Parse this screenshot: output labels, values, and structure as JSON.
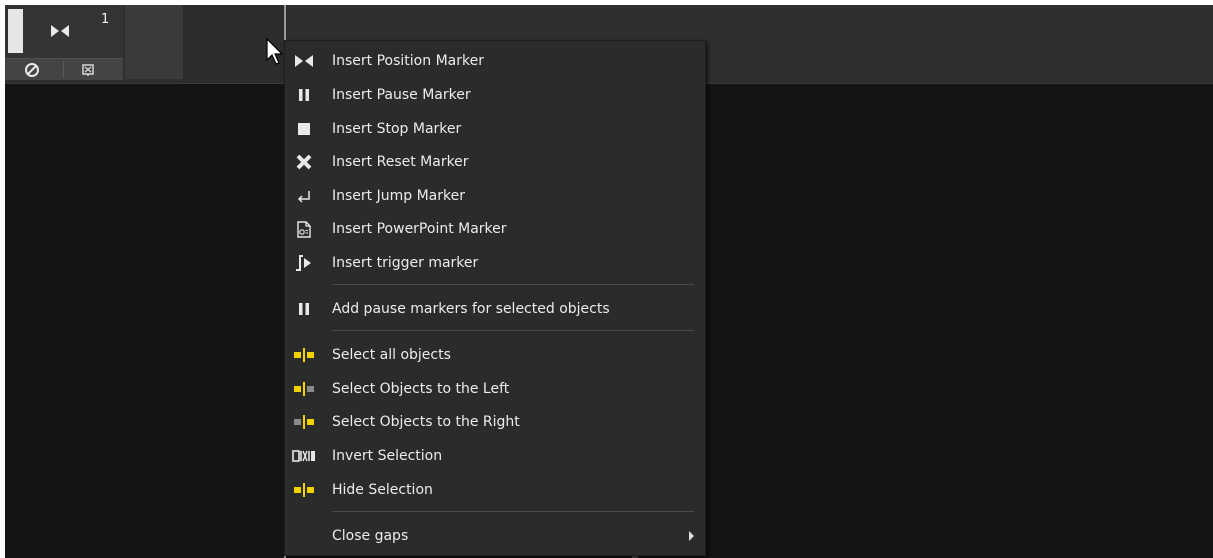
{
  "track": {
    "number": "1",
    "icons": [
      "position-marker-icon",
      "no-symbol-icon",
      "flag-icon"
    ]
  },
  "colors": {
    "background": "#141414",
    "menu_bg": "#2b2b2b",
    "accent_yellow": "#f2d300",
    "text": "#ececec"
  },
  "menu": {
    "items": [
      {
        "label": "Insert Position Marker",
        "icon": "position-marker-icon"
      },
      {
        "label": "Insert Pause Marker",
        "icon": "pause-icon"
      },
      {
        "label": "Insert Stop Marker",
        "icon": "stop-icon"
      },
      {
        "label": "Insert Reset Marker",
        "icon": "reset-x-icon"
      },
      {
        "label": "Insert Jump Marker",
        "icon": "jump-return-icon"
      },
      {
        "label": "Insert PowerPoint Marker",
        "icon": "powerpoint-document-icon"
      },
      {
        "label": "Insert trigger marker",
        "icon": "trigger-icon"
      },
      {
        "label": "Add pause markers for selected objects",
        "icon": "pause-icon"
      },
      {
        "label": "Select all objects",
        "icon": "select-all-icon"
      },
      {
        "label": "Select Objects to the Left",
        "icon": "select-left-icon"
      },
      {
        "label": "Select Objects to the Right",
        "icon": "select-right-icon"
      },
      {
        "label": "Invert Selection",
        "icon": "invert-selection-icon"
      },
      {
        "label": "Hide Selection",
        "icon": "hide-selection-icon"
      },
      {
        "label": "Close gaps",
        "icon": "",
        "submenu": true
      }
    ]
  }
}
